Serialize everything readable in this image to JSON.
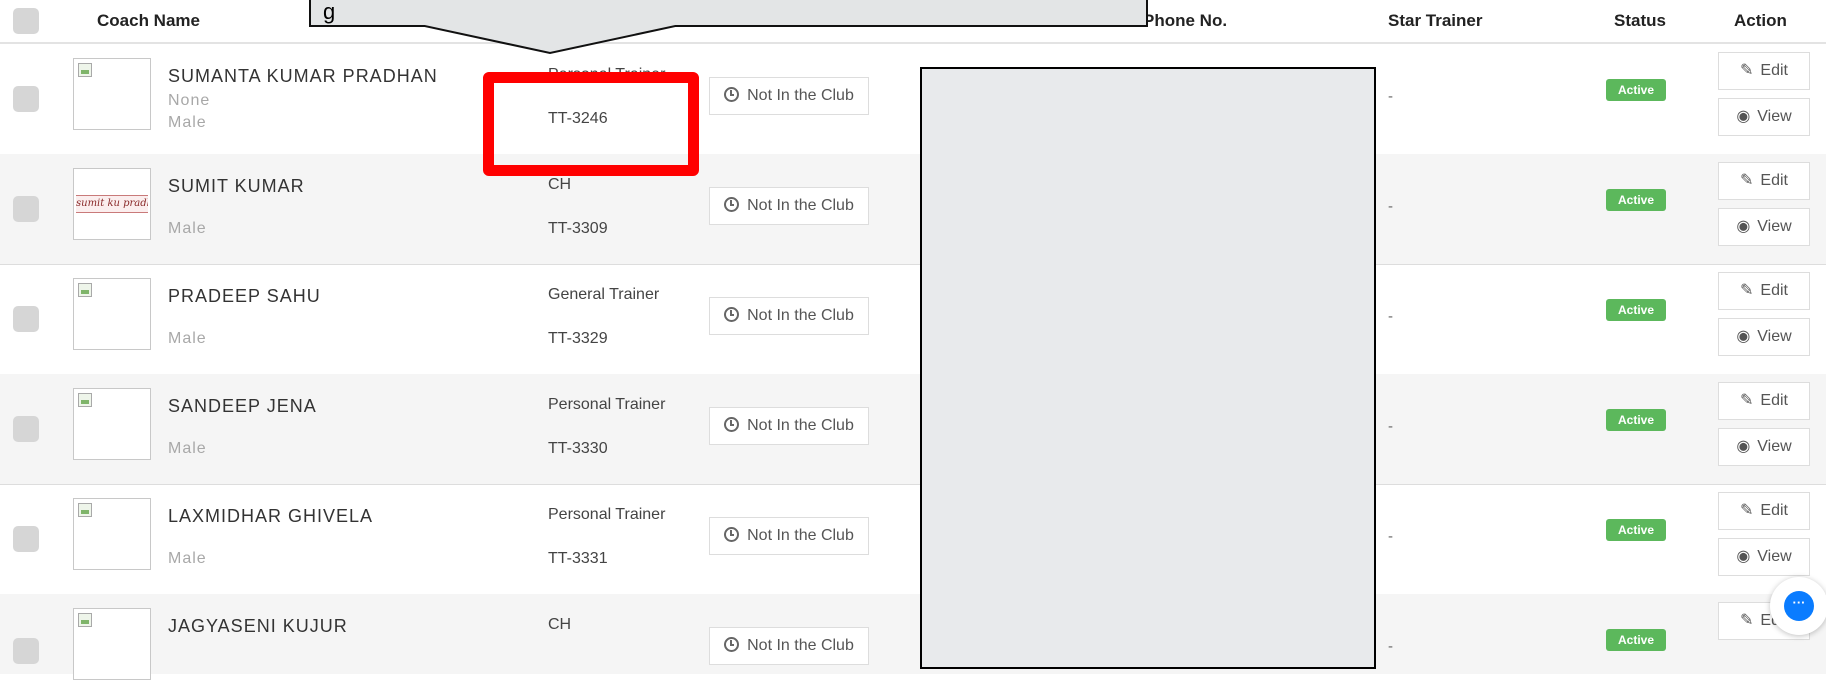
{
  "header": {
    "coach_name": "Coach Name",
    "phone_no": "Phone No.",
    "star_trainer": "Star Trainer",
    "status": "Status",
    "action": "Action"
  },
  "tooltip_text": "g",
  "rows": [
    {
      "name": "SUMANTA KUMAR PRADHAN",
      "detail": "None",
      "gender": "Male",
      "trainer_type": "Personal Trainer",
      "trainer_id": "TT-3246",
      "club_status": "Not In the Club",
      "star_trainer": "-",
      "status": "Active",
      "edit": "Edit",
      "view": "View",
      "photo": "broken-image"
    },
    {
      "name": "SUMIT KUMAR",
      "detail": "",
      "gender": "Male",
      "trainer_type": "CH",
      "trainer_id": "TT-3309",
      "club_status": "Not In the Club",
      "star_trainer": "-",
      "status": "Active",
      "edit": "Edit",
      "view": "View",
      "photo": "signature-image",
      "signature": "sumit ku pradhan"
    },
    {
      "name": "PRADEEP SAHU",
      "detail": "",
      "gender": "Male",
      "trainer_type": "General Trainer",
      "trainer_id": "TT-3329",
      "club_status": "Not In the Club",
      "star_trainer": "-",
      "status": "Active",
      "edit": "Edit",
      "view": "View",
      "photo": "broken-image"
    },
    {
      "name": "SANDEEP JENA",
      "detail": "",
      "gender": "Male",
      "trainer_type": "Personal Trainer",
      "trainer_id": "TT-3330",
      "club_status": "Not In the Club",
      "star_trainer": "-",
      "status": "Active",
      "edit": "Edit",
      "view": "View",
      "photo": "broken-image"
    },
    {
      "name": "LAXMIDHAR GHIVELA",
      "detail": "",
      "gender": "Male",
      "trainer_type": "Personal Trainer",
      "trainer_id": "TT-3331",
      "club_status": "Not In the Club",
      "star_trainer": "-",
      "status": "Active",
      "edit": "Edit",
      "view": "View",
      "photo": "broken-image"
    },
    {
      "name": "JAGYASENI KUJUR",
      "detail": "",
      "gender": "",
      "trainer_type": "CH",
      "trainer_id": "",
      "club_status": "Not In the Club",
      "star_trainer": "-",
      "status": "Active",
      "edit": "Edit",
      "view": "",
      "photo": "broken-image"
    }
  ],
  "icons": {
    "edit": "pencil-icon",
    "view": "eye-icon",
    "club": "clock-icon",
    "chat": "chat-icon"
  },
  "colors": {
    "status_active": "#5cb85c",
    "highlight": "#ff0000",
    "chat": "#0a7cff"
  }
}
